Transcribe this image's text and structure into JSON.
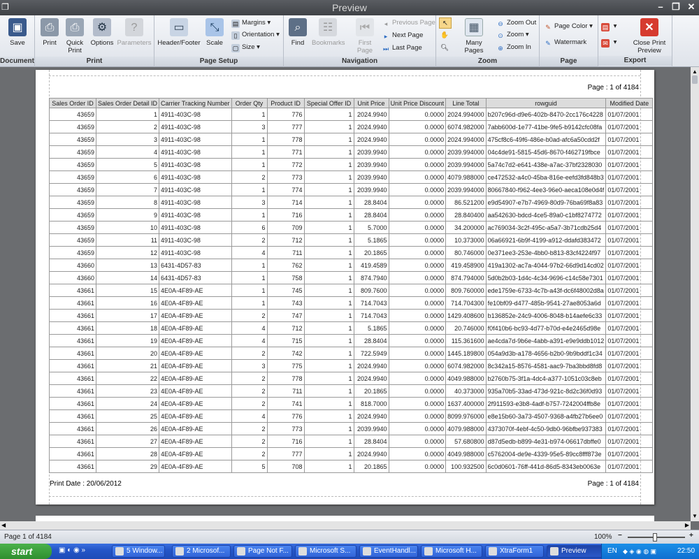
{
  "window": {
    "title": "Preview"
  },
  "ribbon": {
    "groups": {
      "document": "Document",
      "print": "Print",
      "page_setup": "Page Setup",
      "navigation": "Navigation",
      "zoom": "Zoom",
      "page_background": "Page Background",
      "export": "Export"
    },
    "save": "Save",
    "print": "Print",
    "quick_print": "Quick Print",
    "options": "Options",
    "parameters": "Parameters",
    "header_footer": "Header/Footer",
    "scale": "Scale",
    "margins": "Margins",
    "orientation": "Orientation",
    "size": "Size",
    "find": "Find",
    "bookmarks": "Bookmarks",
    "first_page": "First Page",
    "previous_page": "Previous Page",
    "next_page": "Next Page",
    "last_page": "Last Page",
    "many_pages": "Many Pages",
    "zoom_out": "Zoom Out",
    "zoom": "Zoom",
    "zoom_in": "Zoom In",
    "page_color": "Page Color",
    "watermark": "Watermark",
    "close_print_preview": "Close Print Preview"
  },
  "report": {
    "page_header": "Page :  1 of 4184",
    "print_date": "Print Date :  20/06/2012",
    "page_footer": "Page :  1 of 4184",
    "columns": [
      "Sales Order ID",
      "Sales Order Detail ID",
      "Carrier Tracking Number",
      "Order Qty",
      "Product ID",
      "Special Offer ID",
      "Unit Price",
      "Unit Price Discount",
      "Line Total",
      "rowguid",
      "Modified Date"
    ],
    "rows": [
      [
        "43659",
        "1",
        "4911-403C-98",
        "1",
        "776",
        "1",
        "2024.9940",
        "0.0000",
        "2024.994000",
        "b207c96d-d9e6-402b-8470-2cc176c4228",
        "01/07/2001"
      ],
      [
        "43659",
        "2",
        "4911-403C-98",
        "3",
        "777",
        "1",
        "2024.9940",
        "0.0000",
        "6074.982000",
        "7abb600d-1e77-41be-9fe5-b9142cfc08fa",
        "01/07/2001"
      ],
      [
        "43659",
        "3",
        "4911-403C-98",
        "1",
        "778",
        "1",
        "2024.9940",
        "0.0000",
        "2024.994000",
        "475cf8c6-49f6-486e-b0ad-afc6a50cdd2f",
        "01/07/2001"
      ],
      [
        "43659",
        "4",
        "4911-403C-98",
        "1",
        "771",
        "1",
        "2039.9940",
        "0.0000",
        "2039.994000",
        "04c4de91-5815-45d6-8670-f462719fbce",
        "01/07/2001"
      ],
      [
        "43659",
        "5",
        "4911-403C-98",
        "1",
        "772",
        "1",
        "2039.9940",
        "0.0000",
        "2039.994000",
        "5a74c7d2-e641-438e-a7ac-37bf2328030",
        "01/07/2001"
      ],
      [
        "43659",
        "6",
        "4911-403C-98",
        "2",
        "773",
        "1",
        "2039.9940",
        "0.0000",
        "4079.988000",
        "ce472532-a4c0-45ba-816e-eefd3fd848b3",
        "01/07/2001"
      ],
      [
        "43659",
        "7",
        "4911-403C-98",
        "1",
        "774",
        "1",
        "2039.9940",
        "0.0000",
        "2039.994000",
        "80667840-f962-4ee3-96e0-aeca108e0d4f",
        "01/07/2001"
      ],
      [
        "43659",
        "8",
        "4911-403C-98",
        "3",
        "714",
        "1",
        "28.8404",
        "0.0000",
        "86.521200",
        "e9d54907-e7b7-4969-80d9-76ba69f8a83",
        "01/07/2001"
      ],
      [
        "43659",
        "9",
        "4911-403C-98",
        "1",
        "716",
        "1",
        "28.8404",
        "0.0000",
        "28.840400",
        "aa542630-bdcd-4ce5-89a0-c1bf8274772",
        "01/07/2001"
      ],
      [
        "43659",
        "10",
        "4911-403C-98",
        "6",
        "709",
        "1",
        "5.7000",
        "0.0000",
        "34.200000",
        "ac769034-3c2f-495c-a5a7-3b71cdb25d4",
        "01/07/2001"
      ],
      [
        "43659",
        "11",
        "4911-403C-98",
        "2",
        "712",
        "1",
        "5.1865",
        "0.0000",
        "10.373000",
        "06a66921-6b9f-4199-a912-ddafd383472",
        "01/07/2001"
      ],
      [
        "43659",
        "12",
        "4911-403C-98",
        "4",
        "711",
        "1",
        "20.1865",
        "0.0000",
        "80.746000",
        "0e371ee3-253e-4bb0-b813-83cf4224f97",
        "01/07/2001"
      ],
      [
        "43660",
        "13",
        "6431-4D57-83",
        "1",
        "762",
        "1",
        "419.4589",
        "0.0000",
        "419.458900",
        "419a1302-ac7a-4044-97b2-66d9d14cd02",
        "01/07/2001"
      ],
      [
        "43660",
        "14",
        "6431-4D57-83",
        "1",
        "758",
        "1",
        "874.7940",
        "0.0000",
        "874.794000",
        "5d0b2b03-1d4c-4c34-9696-c14c58e7301",
        "01/07/2001"
      ],
      [
        "43661",
        "15",
        "4E0A-4F89-AE",
        "1",
        "745",
        "1",
        "809.7600",
        "0.0000",
        "809.760000",
        "ede1759e-6733-4c7b-a43f-dc6f48002d8a",
        "01/07/2001"
      ],
      [
        "43661",
        "16",
        "4E0A-4F89-AE",
        "1",
        "743",
        "1",
        "714.7043",
        "0.0000",
        "714.704300",
        "fe10bf09-d477-485b-9541-27ae8053a6d",
        "01/07/2001"
      ],
      [
        "43661",
        "17",
        "4E0A-4F89-AE",
        "2",
        "747",
        "1",
        "714.7043",
        "0.0000",
        "1429.408600",
        "b136852e-24c9-4006-8048-b14aefe6c33",
        "01/07/2001"
      ],
      [
        "43661",
        "18",
        "4E0A-4F89-AE",
        "4",
        "712",
        "1",
        "5.1865",
        "0.0000",
        "20.746000",
        "f0f410b6-bc93-4d77-b70d-e4e2465d98e",
        "01/07/2001"
      ],
      [
        "43661",
        "19",
        "4E0A-4F89-AE",
        "4",
        "715",
        "1",
        "28.8404",
        "0.0000",
        "115.361600",
        "ae4cda7d-9b6e-4abb-a391-e9e9ddb1012",
        "01/07/2001"
      ],
      [
        "43661",
        "20",
        "4E0A-4F89-AE",
        "2",
        "742",
        "1",
        "722.5949",
        "0.0000",
        "1445.189800",
        "054a9d3b-a178-4656-b2b0-9b9bddf1c34",
        "01/07/2001"
      ],
      [
        "43661",
        "21",
        "4E0A-4F89-AE",
        "3",
        "775",
        "1",
        "2024.9940",
        "0.0000",
        "6074.982000",
        "8c342a15-8576-4581-aac9-7ba3bbd8fd8",
        "01/07/2001"
      ],
      [
        "43661",
        "22",
        "4E0A-4F89-AE",
        "2",
        "778",
        "1",
        "2024.9940",
        "0.0000",
        "4049.988000",
        "b2760b75-3f1a-4dc4-a377-1051c03c8eb",
        "01/07/2001"
      ],
      [
        "43661",
        "23",
        "4E0A-4F89-AE",
        "2",
        "711",
        "1",
        "20.1865",
        "0.0000",
        "40.373000",
        "935a70b5-33ad-473d-921c-8d2c36f0d93",
        "01/07/2001"
      ],
      [
        "43661",
        "24",
        "4E0A-4F89-AE",
        "2",
        "741",
        "1",
        "818.7000",
        "0.0000",
        "1637.400000",
        "2f911593-e3b8-4adf-b757-7242004ffb8e",
        "01/07/2001"
      ],
      [
        "43661",
        "25",
        "4E0A-4F89-AE",
        "4",
        "776",
        "1",
        "2024.9940",
        "0.0000",
        "8099.976000",
        "e8e15b60-3a73-4507-9368-a4fb27b6ee0",
        "01/07/2001"
      ],
      [
        "43661",
        "26",
        "4E0A-4F89-AE",
        "2",
        "773",
        "1",
        "2039.9940",
        "0.0000",
        "4079.988000",
        "4373070f-4ebf-4c50-9db0-96bfbe937383",
        "01/07/2001"
      ],
      [
        "43661",
        "27",
        "4E0A-4F89-AE",
        "2",
        "716",
        "1",
        "28.8404",
        "0.0000",
        "57.680800",
        "d87d5edb-b899-4e31-b974-06617dbffe0",
        "01/07/2001"
      ],
      [
        "43661",
        "28",
        "4E0A-4F89-AE",
        "2",
        "777",
        "1",
        "2024.9940",
        "0.0000",
        "4049.988000",
        "c5762004-de9e-4339-95e5-89cc8fff873e",
        "01/07/2001"
      ],
      [
        "43661",
        "29",
        "4E0A-4F89-AE",
        "5",
        "708",
        "1",
        "20.1865",
        "0.0000",
        "100.932500",
        "6c0d0601-76ff-441d-86d5-8343eb0063e",
        "01/07/2001"
      ]
    ]
  },
  "status": {
    "page": "Page 1 of 4184",
    "zoom": "100%",
    "zoom_level_percent": 100
  },
  "taskbar": {
    "start": "start",
    "items": [
      "5 Window...",
      "2 Microsof...",
      "Page Not F...",
      "Microsoft S...",
      "EventHandl...",
      "Microsoft H...",
      "XtraForm1",
      "Preview"
    ],
    "lang": "EN",
    "clock": "22:50"
  }
}
